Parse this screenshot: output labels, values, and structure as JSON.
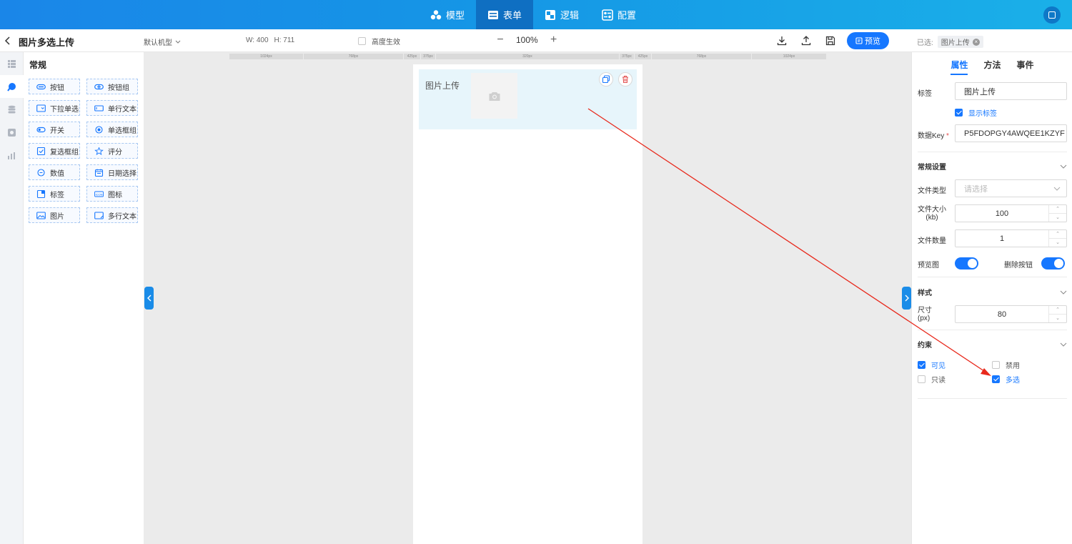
{
  "topbar": {
    "tabs": [
      {
        "label": "模型",
        "icon": "model-icon"
      },
      {
        "label": "表单",
        "icon": "form-icon",
        "active": true
      },
      {
        "label": "逻辑",
        "icon": "logic-icon"
      },
      {
        "label": "配置",
        "icon": "config-icon"
      }
    ]
  },
  "toolbar": {
    "title": "图片多选上传",
    "model_select": "默认机型",
    "width": "W: 400",
    "height": "H: 711",
    "height_effect": "高度生效",
    "zoom": "100%",
    "zoom_out": "−",
    "zoom_in": "+",
    "preview": "预览",
    "selected_label": "已选:",
    "selected_tag": "图片上传"
  },
  "components": {
    "title": "常规",
    "items": [
      {
        "label": "按钮",
        "icon": "button-icon"
      },
      {
        "label": "按钮组",
        "icon": "button-group-icon"
      },
      {
        "label": "下拉单选",
        "icon": "dropdown-icon"
      },
      {
        "label": "单行文本",
        "icon": "text-input-icon"
      },
      {
        "label": "开关",
        "icon": "switch-icon"
      },
      {
        "label": "单选框组",
        "icon": "radio-icon"
      },
      {
        "label": "复选框组",
        "icon": "checkbox-icon"
      },
      {
        "label": "评分",
        "icon": "star-icon"
      },
      {
        "label": "数值",
        "icon": "number-icon"
      },
      {
        "label": "日期选择",
        "icon": "calendar-icon"
      },
      {
        "label": "标签",
        "icon": "label-icon"
      },
      {
        "label": "图标",
        "icon": "icon-icon"
      },
      {
        "label": "图片",
        "icon": "image-icon"
      },
      {
        "label": "多行文本",
        "icon": "textarea-icon"
      }
    ]
  },
  "ruler": [
    "1024px",
    "768px",
    "425px",
    "375px",
    "320px",
    "375px",
    "425px",
    "768px",
    "1024px"
  ],
  "canvas": {
    "upload_label": "图片上传"
  },
  "props": {
    "tabs": [
      "属性",
      "方法",
      "事件"
    ],
    "label_title": "标签",
    "label_value": "图片上传",
    "show_label": "显示标签",
    "key_title": "数据Key",
    "key_required": "*",
    "key_value": "P5FDOPGY4AWQEE1KZYF",
    "section_general": "常规设置",
    "file_type_title": "文件类型",
    "file_type_placeholder": "请选择",
    "file_size_title": "文件大小",
    "file_size_unit": "(kb)",
    "file_size_value": "100",
    "file_count_title": "文件数量",
    "file_count_value": "1",
    "preview_title": "预览图",
    "delete_title": "删除按钮",
    "section_style": "样式",
    "size_title": "尺寸",
    "size_unit": "(px)",
    "size_value": "80",
    "section_constraint": "约束",
    "visible": "可见",
    "disabled": "禁用",
    "readonly": "只读",
    "multiple": "多选"
  },
  "colors": {
    "accent": "#1677ff",
    "topbar": "#1a86e8",
    "annotation_arrow": "#e8291c"
  }
}
